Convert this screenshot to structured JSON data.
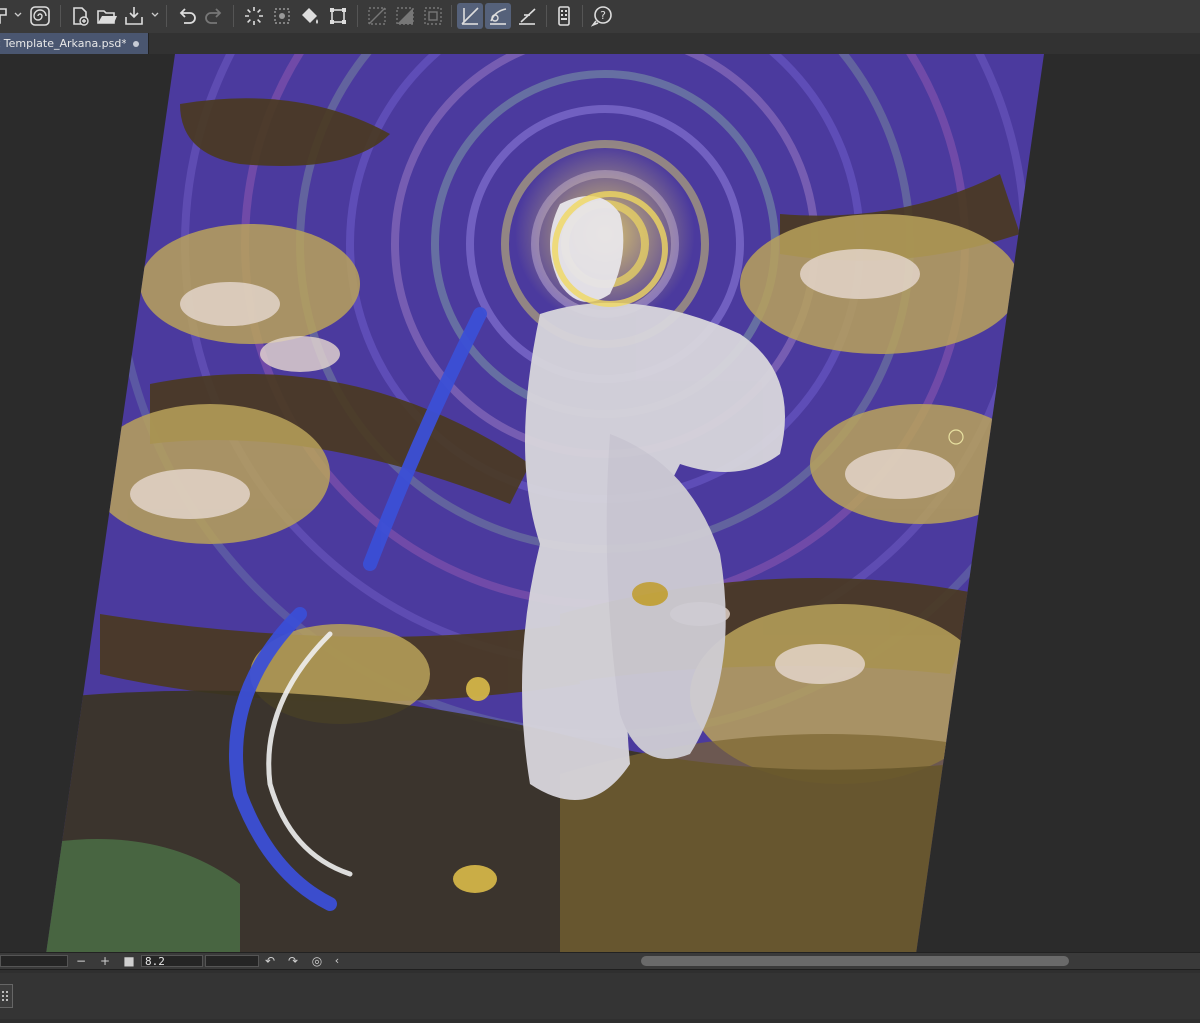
{
  "toolbar": {
    "icons": [
      "brush-menu-icon",
      "spiral-icon",
      "new-canvas-icon",
      "open-folder-icon",
      "save-icon",
      "undo-icon",
      "redo-icon",
      "loading-icon",
      "dotted-selection-icon",
      "fill-icon",
      "transform-icon",
      "clear-selection-icon",
      "invert-selection-icon",
      "selection-border-icon",
      "ruler-snap-icon",
      "curve-snap-icon",
      "perspective-snap-icon",
      "device-icon",
      "help-icon"
    ],
    "active_color": "#55617a"
  },
  "tabs": [
    {
      "label": "t Template_Arkana.psd*",
      "modified": true
    }
  ],
  "status": {
    "zoom_value": "8.2",
    "minus_label": "−",
    "plus_label": "+",
    "left_caret": "‹"
  },
  "colors": {
    "background": "#2b2b2b",
    "toolbar": "#3a3a3a",
    "tab_active": "#4a5670",
    "artwork_purple": "#4b3a9e",
    "artwork_gold": "#b8a25a"
  }
}
